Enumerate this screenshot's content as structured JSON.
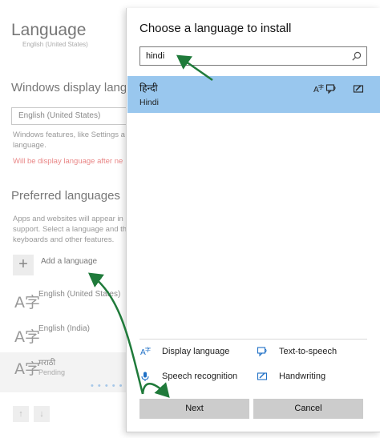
{
  "background": {
    "page_title": "Language",
    "page_subtitle": "English (United States)",
    "display_section_title": "Windows display langu",
    "display_dropdown_value": "English (United States)",
    "display_description": "Windows features, like Settings a language.",
    "display_warning": "Will be display language after ne",
    "preferred_section_title": "Preferred languages",
    "preferred_description": "Apps and websites will appear in support. Select a language and th keyboards and other features.",
    "add_language_label": "Add a language",
    "languages": [
      {
        "glyph": "A字",
        "name": "English (United States)",
        "status": ""
      },
      {
        "glyph": "A字",
        "name": "English (India)",
        "status": ""
      },
      {
        "glyph": "A字",
        "name": "मराठी",
        "status": "Pending"
      }
    ],
    "progress_dots": "• • • • •"
  },
  "dialog": {
    "title": "Choose a language to install",
    "search": {
      "value": "hindi",
      "placeholder": ""
    },
    "result": {
      "native_name": "हिन्दी",
      "english_name": "Hindi",
      "feature_icons": [
        "display-language-icon",
        "text-to-speech-icon",
        "handwriting-icon"
      ]
    },
    "features": [
      {
        "label": "Display language",
        "icon": "display-language-icon"
      },
      {
        "label": "Text-to-speech",
        "icon": "text-to-speech-icon"
      },
      {
        "label": "Speech recognition",
        "icon": "microphone-icon"
      },
      {
        "label": "Handwriting",
        "icon": "handwriting-icon"
      }
    ],
    "buttons": {
      "next": "Next",
      "cancel": "Cancel"
    }
  },
  "colors": {
    "selection": "#99c7ee",
    "icon_blue": "#1e6fc5",
    "annotation_arrow": "#1f7a3a",
    "warning_text": "#e98787",
    "button_bg": "#cccccc"
  }
}
